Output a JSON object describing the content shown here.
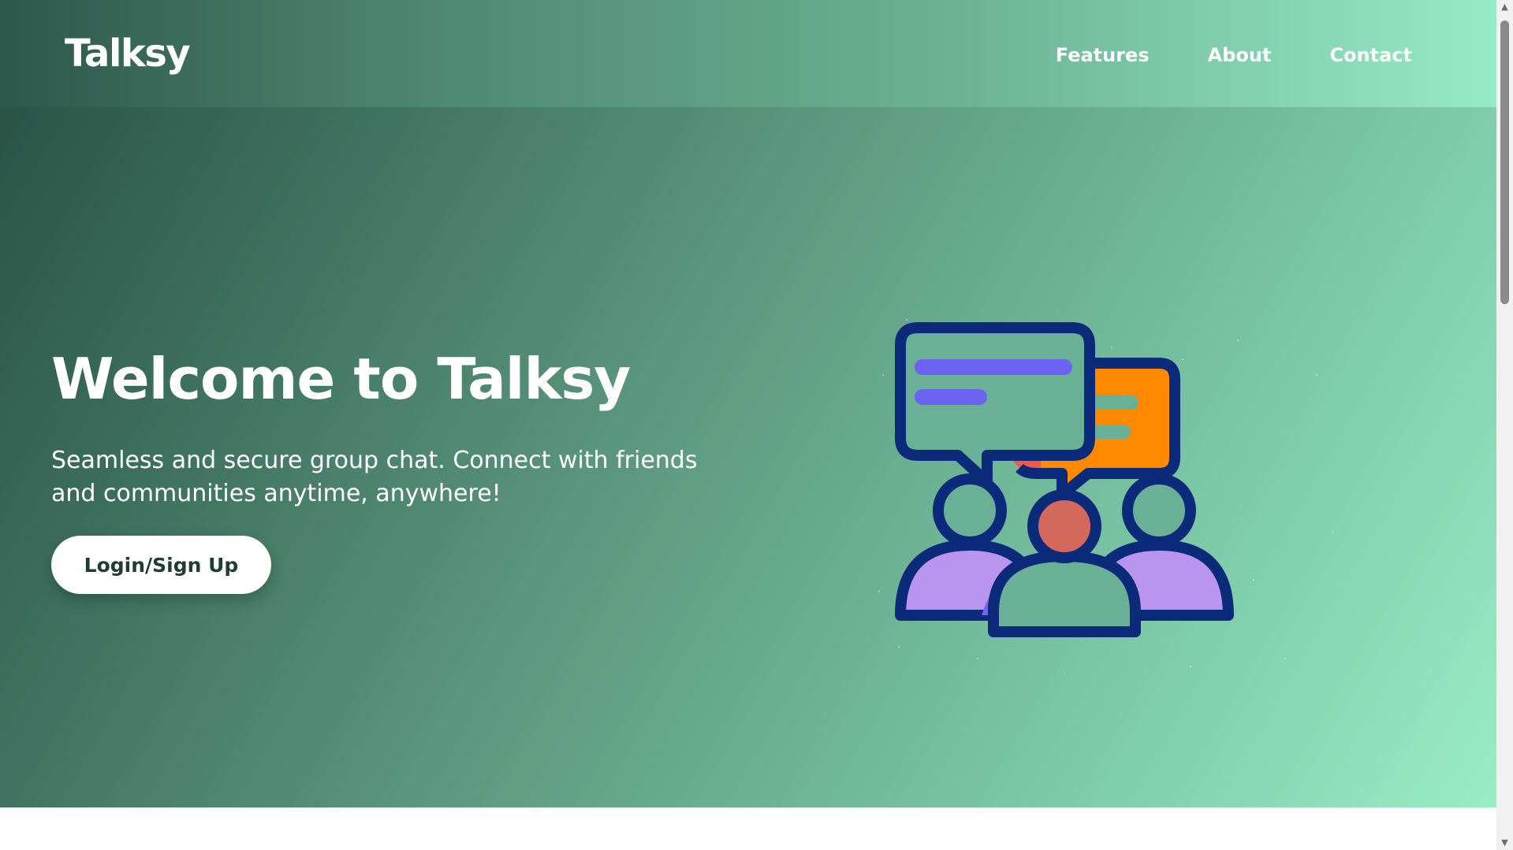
{
  "header": {
    "logo": "Talksy",
    "nav": [
      {
        "label": "Features"
      },
      {
        "label": "About"
      },
      {
        "label": "Contact"
      }
    ]
  },
  "hero": {
    "title": "Welcome to Talksy",
    "subtitle": "Seamless and secure group chat. Connect with friends and communities anytime, anywhere!",
    "cta_label": "Login/Sign Up",
    "illustration_icon": "group-chat-illustration-icon"
  },
  "colors": {
    "header_gradient_start": "#2e574b",
    "header_gradient_end": "#95ebc5",
    "hero_gradient_start": "#2a5346",
    "hero_gradient_end": "#98edc6",
    "icon_outline": "#0c2a7a",
    "bubble_bar": "#6c63f2",
    "bubble_orange": "#ff8a00",
    "bubble_red": "#f05a4a",
    "person_purple": "#b995f0",
    "person_accent": "#7164f2",
    "person_center_head": "#d4685c",
    "button_bg": "#ffffff",
    "button_text": "#1f3d33"
  },
  "scrollbar": {
    "up_icon": "scroll-up-arrow-icon",
    "down_icon": "scroll-down-arrow-icon"
  }
}
